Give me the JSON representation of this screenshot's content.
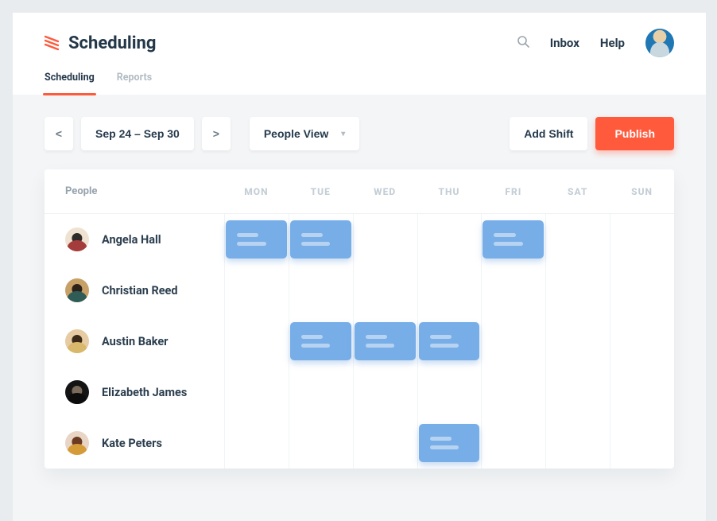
{
  "header": {
    "app_title": "Scheduling",
    "nav": {
      "inbox": "Inbox",
      "help": "Help"
    },
    "tabs": [
      {
        "id": "scheduling",
        "label": "Scheduling",
        "active": true
      },
      {
        "id": "reports",
        "label": "Reports",
        "active": false
      }
    ]
  },
  "toolbar": {
    "prev": "<",
    "next": ">",
    "date_range": "Sep 24 – Sep 30",
    "view_label": "People View",
    "add_shift": "Add Shift",
    "publish": "Publish"
  },
  "grid": {
    "people_header": "People",
    "days": [
      "MON",
      "TUE",
      "WED",
      "THU",
      "FRI",
      "SAT",
      "SUN"
    ],
    "rows": [
      {
        "name": "Angela Hall",
        "avatar": "av-0",
        "shifts": [
          0,
          1,
          4
        ]
      },
      {
        "name": "Christian Reed",
        "avatar": "av-1",
        "shifts": []
      },
      {
        "name": "Austin Baker",
        "avatar": "av-2",
        "shifts": [
          1,
          2,
          3
        ]
      },
      {
        "name": "Elizabeth James",
        "avatar": "av-3",
        "shifts": []
      },
      {
        "name": "Kate Peters",
        "avatar": "av-4",
        "shifts": [
          3
        ]
      }
    ]
  },
  "colors": {
    "accent": "#ff5a3c",
    "shift": "#77aee8"
  }
}
